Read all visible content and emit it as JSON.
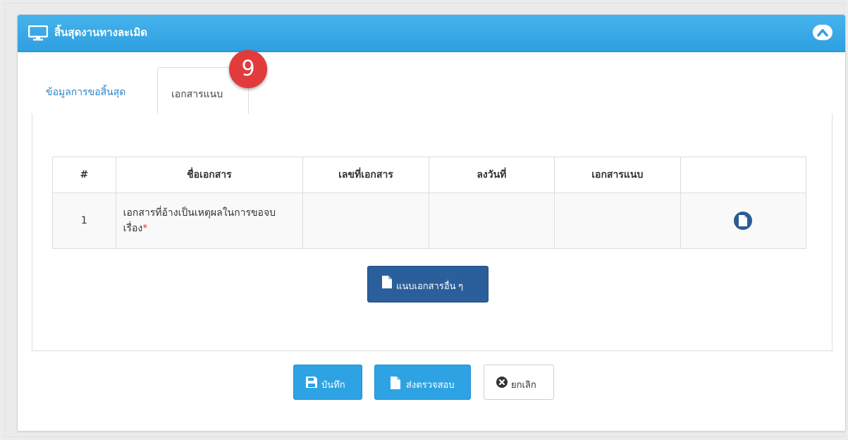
{
  "header": {
    "title": "สิ้นสุดงานทางละเมิด"
  },
  "tabs": [
    {
      "label": "ข้อมูลการขอสิ้นสุด"
    },
    {
      "label": "เอกสารแนบ"
    }
  ],
  "step_badge": "9",
  "table": {
    "headers": [
      "#",
      "ชื่อเอกสาร",
      "เลขที่เอกสาร",
      "ลงวันที่",
      "เอกสารแนบ",
      ""
    ],
    "rows": [
      {
        "num": "1",
        "name": "เอกสารที่อ้างเป็นเหตุผลในการขอจบเรื่อง",
        "required_mark": "*",
        "doc_no": "",
        "date": "",
        "attachment": ""
      }
    ]
  },
  "attach_other_label": "แนบเอกสารอื่น ๆ",
  "buttons": {
    "save": "บันทึก",
    "submit": "ส่งตรวจสอบ",
    "cancel": "ยกเลิก"
  },
  "colors": {
    "header": "#2e9fe0",
    "badge": "#e23b3b",
    "dark_button": "#2b5f9b",
    "primary_button": "#2da3e3"
  }
}
